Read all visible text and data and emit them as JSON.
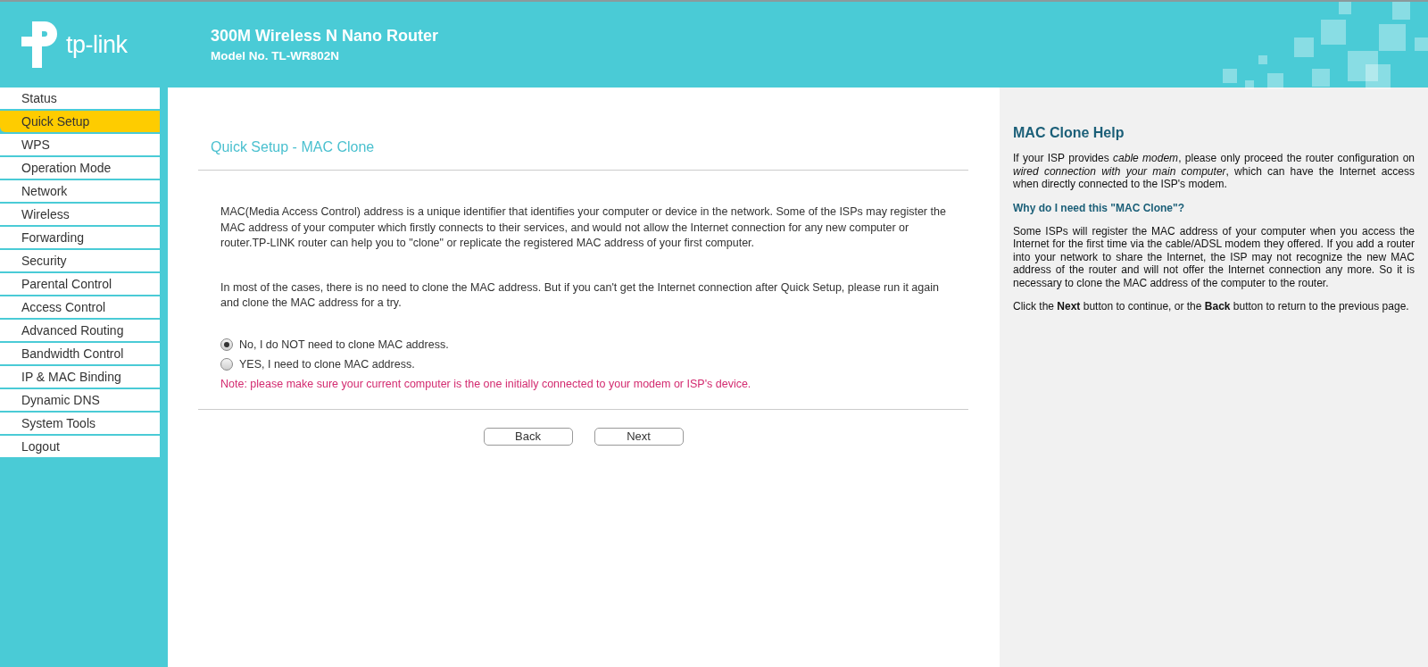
{
  "header": {
    "logo_text": "tp-link",
    "product": "300M Wireless N Nano Router",
    "model": "Model No. TL-WR802N"
  },
  "sidebar": {
    "items": [
      {
        "label": "Status",
        "selected": false
      },
      {
        "label": "Quick Setup",
        "selected": true
      },
      {
        "label": "WPS",
        "selected": false
      },
      {
        "label": "Operation Mode",
        "selected": false
      },
      {
        "label": "Network",
        "selected": false
      },
      {
        "label": "Wireless",
        "selected": false
      },
      {
        "label": "Forwarding",
        "selected": false
      },
      {
        "label": "Security",
        "selected": false
      },
      {
        "label": "Parental Control",
        "selected": false
      },
      {
        "label": "Access Control",
        "selected": false
      },
      {
        "label": "Advanced Routing",
        "selected": false
      },
      {
        "label": "Bandwidth Control",
        "selected": false
      },
      {
        "label": "IP & MAC Binding",
        "selected": false
      },
      {
        "label": "Dynamic DNS",
        "selected": false
      },
      {
        "label": "System Tools",
        "selected": false
      },
      {
        "label": "Logout",
        "selected": false
      }
    ]
  },
  "main": {
    "title": "Quick Setup - MAC Clone",
    "paragraphs": [
      "MAC(Media Access Control) address is a unique identifier that identifies your computer or device in the network. Some of the ISPs may register the MAC address of your computer which firstly connects to their services, and would not allow the Internet connection for any new computer or router.TP-LINK router can help you to \"clone\" or replicate the registered MAC address of your first computer.",
      "In most of the cases, there is no need to clone the MAC address. But if you can't get the Internet connection after Quick Setup, please run it again and clone the MAC address for a try."
    ],
    "options": [
      {
        "label": "No, I do NOT need to clone MAC address.",
        "selected": true
      },
      {
        "label": "YES, I need to clone MAC address.",
        "selected": false
      }
    ],
    "note": "Note: please make sure your current computer is the one initially connected to your modem or ISP's device.",
    "buttons": [
      "Back",
      "Next"
    ]
  },
  "help": {
    "title": "MAC Clone Help",
    "blocks": [
      {
        "kind": "text",
        "text": "If your ISP provides *cable modem*, please only proceed the router configuration on *wired connection with your main computer*, which can have the Internet access when directly connected to the ISP's modem."
      },
      {
        "kind": "heading",
        "text": "Why do I need this \"MAC Clone\"?"
      },
      {
        "kind": "text",
        "text": "Some ISPs will register the MAC address of your computer when you access the Internet for the first time via the cable/ADSL modem they offered. If you add a router into your network to share the Internet, the ISP may not recognize the new MAC address of the router and will not offer the Internet connection any more. So it is necessary to clone the MAC address of the computer to the router."
      },
      {
        "kind": "text",
        "text": "Click the **Next** button to continue, or the **Back** button to return to the previous page."
      }
    ]
  }
}
